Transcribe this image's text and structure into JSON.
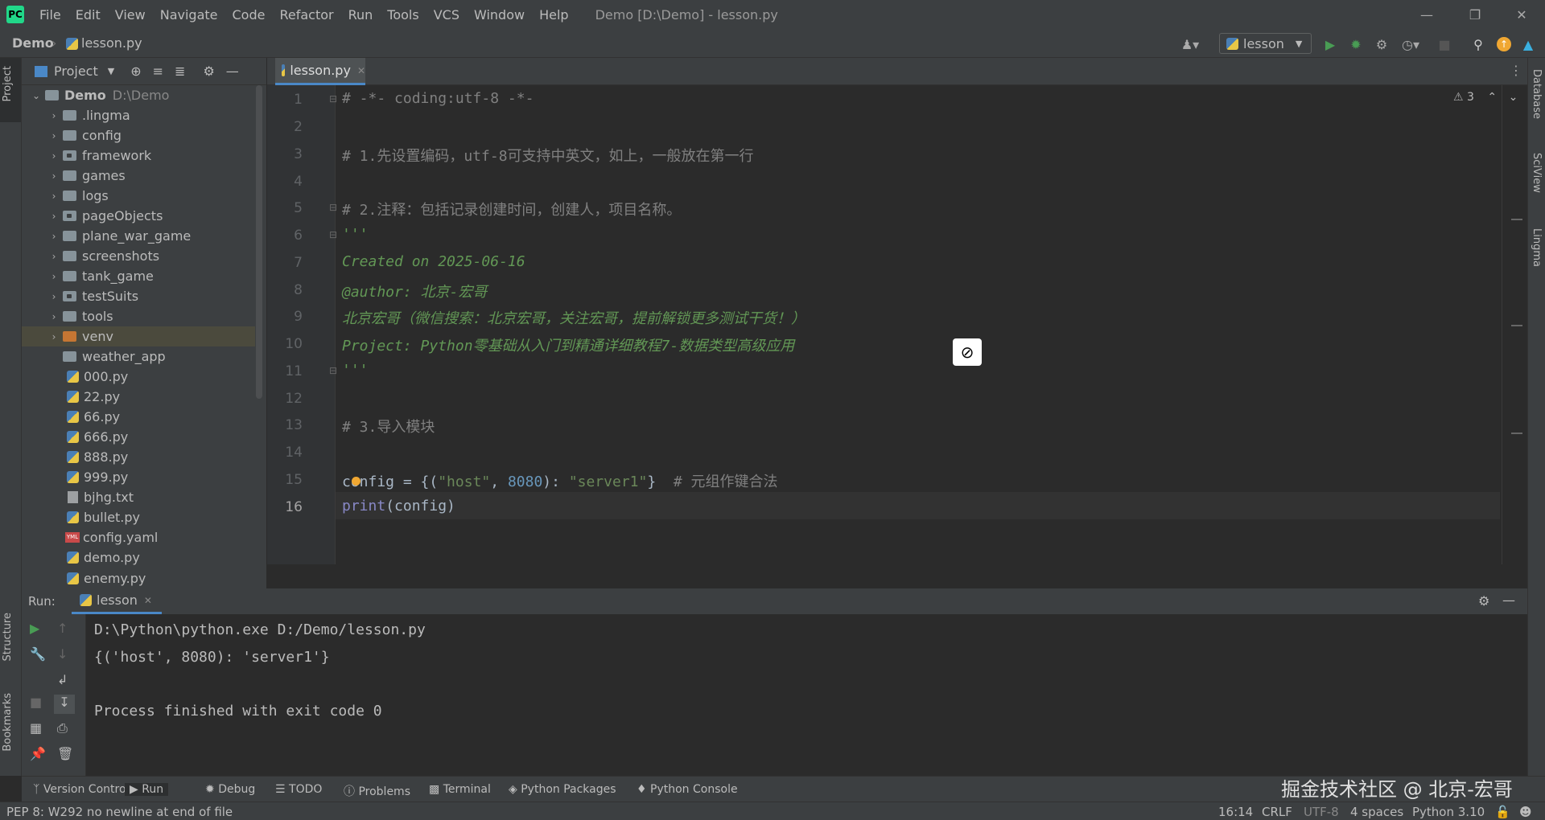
{
  "menu": [
    "File",
    "Edit",
    "View",
    "Navigate",
    "Code",
    "Refactor",
    "Run",
    "Tools",
    "VCS",
    "Window",
    "Help"
  ],
  "window_title": "Demo [D:\\Demo] - lesson.py",
  "breadcrumb": {
    "project": "Demo",
    "file": "lesson.py"
  },
  "run_config": "lesson",
  "project_panel": {
    "title": "Project",
    "root_name": "Demo",
    "root_path": "D:\\Demo",
    "items": [
      {
        "name": ".lingma",
        "type": "folder"
      },
      {
        "name": "config",
        "type": "folder"
      },
      {
        "name": "framework",
        "type": "package"
      },
      {
        "name": "games",
        "type": "folder"
      },
      {
        "name": "logs",
        "type": "folder"
      },
      {
        "name": "pageObjects",
        "type": "package"
      },
      {
        "name": "plane_war_game",
        "type": "folder"
      },
      {
        "name": "screenshots",
        "type": "folder"
      },
      {
        "name": "tank_game",
        "type": "folder"
      },
      {
        "name": "testSuits",
        "type": "package"
      },
      {
        "name": "tools",
        "type": "folder"
      },
      {
        "name": "venv",
        "type": "venv"
      },
      {
        "name": "weather_app",
        "type": "folder"
      },
      {
        "name": "000.py",
        "type": "py"
      },
      {
        "name": "22.py",
        "type": "py"
      },
      {
        "name": "66.py",
        "type": "py"
      },
      {
        "name": "666.py",
        "type": "py"
      },
      {
        "name": "888.py",
        "type": "py"
      },
      {
        "name": "999.py",
        "type": "py"
      },
      {
        "name": "bjhg.txt",
        "type": "txt"
      },
      {
        "name": "bullet.py",
        "type": "py"
      },
      {
        "name": "config.yaml",
        "type": "yml"
      },
      {
        "name": "demo.py",
        "type": "py"
      },
      {
        "name": "enemy.py",
        "type": "py"
      }
    ]
  },
  "editor": {
    "tab": "lesson.py",
    "warnings": "3",
    "line_numbers": [
      "1",
      "2",
      "3",
      "4",
      "5",
      "6",
      "7",
      "8",
      "9",
      "10",
      "11",
      "12",
      "13",
      "14",
      "15",
      "16"
    ],
    "lines": {
      "l1": "# -*- coding:utf-8 -*-",
      "l3": "# 1.先设置编码，utf-8可支持中英文，如上，一般放在第一行",
      "l5": "# 2.注释：包括记录创建时间，创建人，项目名称。",
      "l6": "'''",
      "l7": "Created on 2025-06-16",
      "l8": "@author: 北京-宏哥",
      "l9": "北京宏哥（微信搜索：北京宏哥，关注宏哥，提前解锁更多测试干货！）",
      "l10": "Project: Python零基础从入门到精通详细教程7-数据类型高级应用",
      "l11": "'''",
      "l13": "# 3.导入模块",
      "l15_a": "config = {(",
      "l15_b": "\"host\"",
      "l15_c": ", ",
      "l15_d": "8080",
      "l15_e": "): ",
      "l15_f": "\"server1\"",
      "l15_g": "}  ",
      "l15_h": "# 元组作键合法",
      "l16_a": "print",
      "l16_b": "(config)"
    }
  },
  "run": {
    "label": "Run:",
    "tab": "lesson",
    "output": [
      "D:\\Python\\python.exe D:/Demo/lesson.py",
      "{('host', 8080): 'server1'}",
      "",
      "Process finished with exit code 0"
    ]
  },
  "left_tabs": [
    "Project",
    "Structure",
    "Bookmarks"
  ],
  "right_tabs": [
    "Database",
    "SciView",
    "Lingma"
  ],
  "bottom_tools": [
    "Version Control",
    "Run",
    "Debug",
    "TODO",
    "Problems",
    "Terminal",
    "Python Packages",
    "Python Console"
  ],
  "status": {
    "message": "PEP 8: W292 no newline at end of file",
    "position": "16:14",
    "line_sep": "CRLF",
    "encoding": "UTF-8",
    "indent": "4 spaces",
    "interpreter": "Python 3.10"
  },
  "watermark": "掘金技术社区 @ 北京-宏哥",
  "colors": {
    "bg": "#2b2b2b",
    "panel": "#3c3f41",
    "comment": "#808080",
    "docstring": "#629755",
    "string": "#6a8759",
    "number": "#6897bb",
    "builtin": "#8888c6",
    "run_green": "#499c54"
  }
}
